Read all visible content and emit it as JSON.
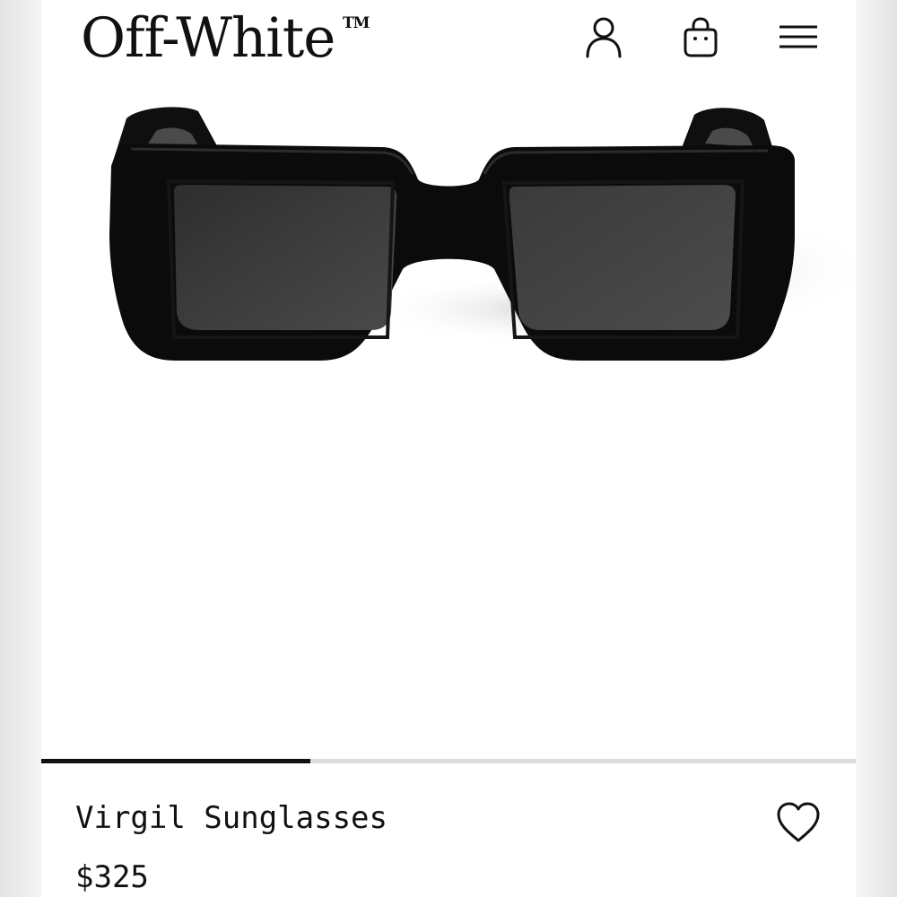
{
  "header": {
    "brand": "Off-White",
    "trademark": "TM",
    "account_icon": "user-icon",
    "bag_icon": "shopping-bag-icon",
    "menu_icon": "hamburger-menu-icon"
  },
  "gallery": {
    "image_subject": "black square-frame sunglasses",
    "progress": 0.33
  },
  "product": {
    "name": "Virgil Sunglasses",
    "price": "$325",
    "wishlist_icon": "heart-icon"
  },
  "colors": {
    "text": "#111111",
    "background": "#ffffff",
    "track": "#dcdcdc"
  }
}
